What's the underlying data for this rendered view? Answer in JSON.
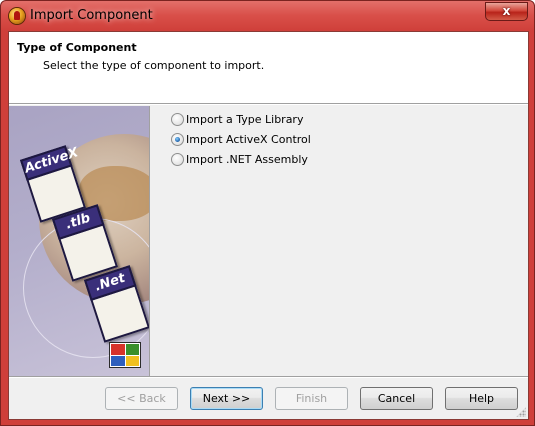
{
  "window": {
    "title": "Import Component",
    "close_label": "x"
  },
  "header": {
    "title": "Type of Component",
    "subtitle": "Select the type of component to import."
  },
  "illustration": {
    "card_labels": [
      "ActiveX",
      ".tlb",
      ".Net"
    ]
  },
  "options": [
    {
      "label": "Import a Type Library",
      "checked": false
    },
    {
      "label": "Import ActiveX Control",
      "checked": true
    },
    {
      "label": "Import .NET Assembly",
      "checked": false
    }
  ],
  "buttons": {
    "back": {
      "label": "<< Back",
      "enabled": false
    },
    "next": {
      "label": "Next >>",
      "enabled": true
    },
    "finish": {
      "label": "Finish",
      "enabled": false
    },
    "cancel": {
      "label": "Cancel",
      "enabled": true
    },
    "help": {
      "label": "Help",
      "enabled": true
    }
  },
  "colors": {
    "titlebar": "#d9504a",
    "close_button": "#c42b1c",
    "radio_selected": "#1d5fa8"
  }
}
